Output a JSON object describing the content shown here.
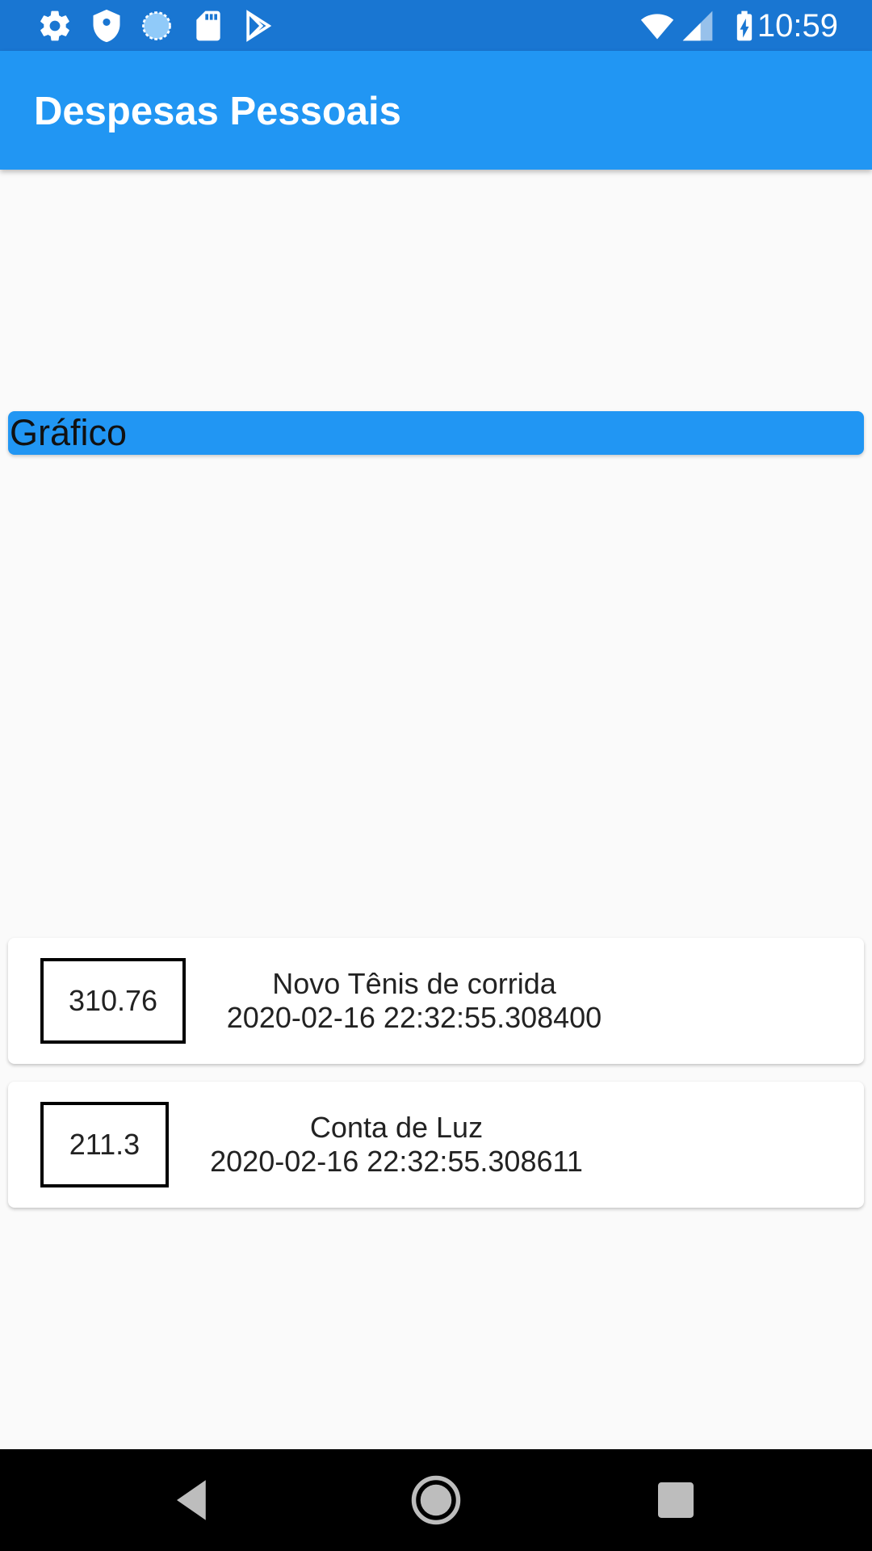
{
  "status_bar": {
    "time": "10:59",
    "left_icons": [
      "settings-icon",
      "shield-icon",
      "sync-icon",
      "sd-card-icon",
      "play-store-icon"
    ],
    "right_icons": [
      "wifi-icon",
      "signal-icon",
      "battery-charging-icon"
    ]
  },
  "app_bar": {
    "title": "Despesas Pessoais",
    "color": "#2196f3"
  },
  "chart_card": {
    "label": "Gráfico",
    "color": "#2196f3"
  },
  "transactions": [
    {
      "amount": "310.76",
      "title": "Novo Tênis de corrida",
      "date": "2020-02-16 22:32:55.308400"
    },
    {
      "amount": "211.3",
      "title": "Conta de Luz",
      "date": "2020-02-16 22:32:55.308611"
    }
  ],
  "nav_bar": {
    "buttons": [
      "back-icon",
      "home-icon",
      "recents-icon"
    ]
  }
}
